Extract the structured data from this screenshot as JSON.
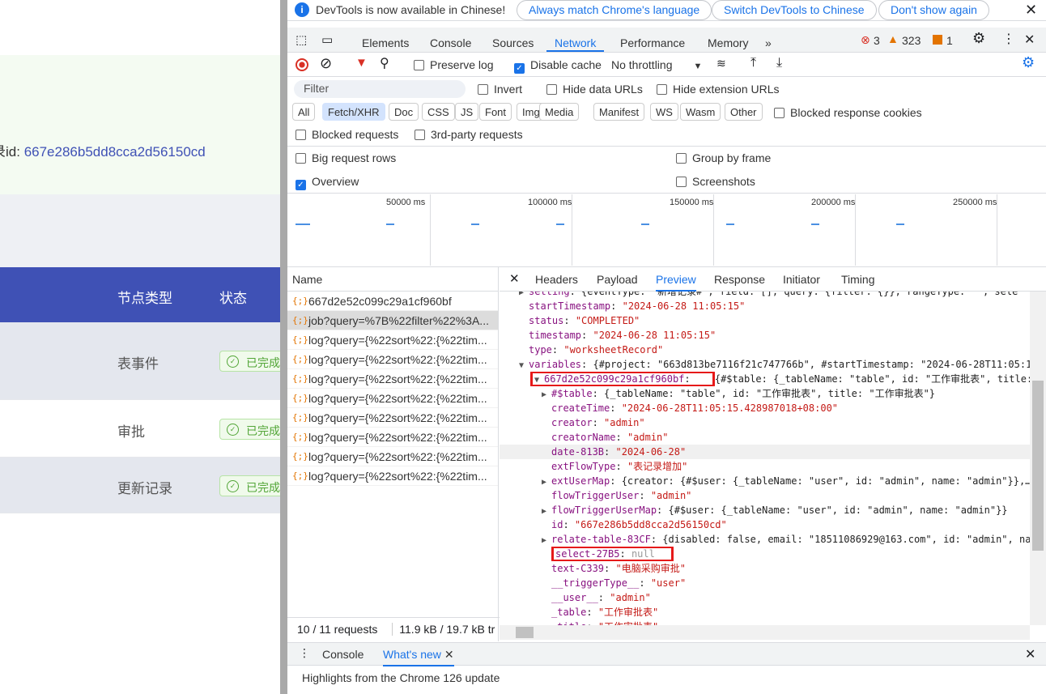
{
  "page": {
    "record_label": "录id: ",
    "record_id": "667e286b5dd8cca2d56150cd",
    "table_headers": [
      "节点类型",
      "状态"
    ],
    "rows": [
      {
        "type": "表事件",
        "status": "已完成"
      },
      {
        "type": "审批",
        "status": "已完成"
      },
      {
        "type": "更新记录",
        "status": "已完成"
      }
    ]
  },
  "devtools": {
    "infobar": {
      "message": "DevTools is now available in Chinese!",
      "buttons": [
        "Always match Chrome's language",
        "Switch DevTools to Chinese",
        "Don't show again"
      ]
    },
    "tabs": [
      "Elements",
      "Console",
      "Sources",
      "Network",
      "Performance",
      "Memory"
    ],
    "active_tab": "Network",
    "counts": {
      "errors": "3",
      "warnings": "323",
      "issues": "1"
    },
    "toolbar": {
      "preserve_log": "Preserve log",
      "disable_cache": "Disable cache",
      "throttling": "No throttling"
    },
    "filter": {
      "placeholder": "Filter",
      "invert": "Invert",
      "hide_data": "Hide data URLs",
      "hide_ext": "Hide extension URLs"
    },
    "types": [
      "All",
      "Fetch/XHR",
      "Doc",
      "CSS",
      "JS",
      "Font",
      "Img",
      "Media",
      "Manifest",
      "WS",
      "Wasm",
      "Other"
    ],
    "active_type": "Fetch/XHR",
    "blocked_cookies": "Blocked response cookies",
    "blocked_requests": "Blocked requests",
    "third_party": "3rd-party requests",
    "big_rows": "Big request rows",
    "group_frame": "Group by frame",
    "overview": "Overview",
    "screenshots": "Screenshots",
    "timeline_ticks": [
      "50000 ms",
      "100000 ms",
      "150000 ms",
      "200000 ms",
      "250000 ms"
    ],
    "name_header": "Name",
    "requests": [
      "667d2e52c099c29a1cf960bf",
      "job?query=%7B%22filter%22%3A...",
      "log?query={%22sort%22:{%22tim...",
      "log?query={%22sort%22:{%22tim...",
      "log?query={%22sort%22:{%22tim...",
      "log?query={%22sort%22:{%22tim...",
      "log?query={%22sort%22:{%22tim...",
      "log?query={%22sort%22:{%22tim...",
      "log?query={%22sort%22:{%22tim...",
      "log?query={%22sort%22:{%22tim..."
    ],
    "detail_tabs": [
      "Headers",
      "Payload",
      "Preview",
      "Response",
      "Initiator",
      "Timing"
    ],
    "active_detail": "Preview",
    "status_bar": {
      "requests": "10 / 11 requests",
      "size": "11.9 kB / 19.7 kB tr"
    },
    "drawer": {
      "tabs": [
        "Console",
        "What's new"
      ],
      "text": "Highlights from the Chrome 126 update"
    },
    "preview": [
      {
        "i": 0,
        "t": "c",
        "k": "setting",
        "v": "{eventType: \"新增记录#\", field: [], query: {filter: {}}, rangeType: \"\", sele"
      },
      {
        "i": 0,
        "k": "startTimestamp",
        "v": "\"2024-06-28 11:05:15\"",
        "s": 1
      },
      {
        "i": 0,
        "k": "status",
        "v": "\"COMPLETED\"",
        "s": 1
      },
      {
        "i": 0,
        "k": "timestamp",
        "v": "\"2024-06-28 11:05:15\"",
        "s": 1
      },
      {
        "i": 0,
        "k": "type",
        "v": "\"worksheetRecord\"",
        "s": 1
      },
      {
        "i": 0,
        "t": "o",
        "k": "variables",
        "v": "{#project: \"663d813be7116f21c747766b\", #startTimestamp: \"2024-06-28T11:05:1"
      },
      {
        "i": 1,
        "t": "o",
        "k": "667d2e52c099c29a1cf960bf",
        "v": "{#$table: {_tableName: \"table\", id: \"工作审批表\", title: \"工",
        "box": 1
      },
      {
        "i": 2,
        "t": "c",
        "k": "#$table",
        "v": "{_tableName: \"table\", id: \"工作审批表\", title: \"工作审批表\"}"
      },
      {
        "i": 2,
        "k": "createTime",
        "v": "\"2024-06-28T11:05:15.428987018+08:00\"",
        "s": 1
      },
      {
        "i": 2,
        "k": "creator",
        "v": "\"admin\"",
        "s": 1
      },
      {
        "i": 2,
        "k": "creatorName",
        "v": "\"admin\"",
        "s": 1
      },
      {
        "i": 2,
        "k": "date-813B",
        "v": "\"2024-06-28\"",
        "s": 1,
        "hl": 1
      },
      {
        "i": 2,
        "k": "extFlowType",
        "v": "\"表记录增加\"",
        "s": 1
      },
      {
        "i": 2,
        "t": "c",
        "k": "extUserMap",
        "v": "{creator: {#$user: {_tableName: \"user\", id: \"admin\", name: \"admin\"}},…"
      },
      {
        "i": 2,
        "k": "flowTriggerUser",
        "v": "\"admin\"",
        "s": 1
      },
      {
        "i": 2,
        "t": "c",
        "k": "flowTriggerUserMap",
        "v": "{#$user: {_tableName: \"user\", id: \"admin\", name: \"admin\"}}"
      },
      {
        "i": 2,
        "k": "id",
        "v": "\"667e286b5dd8cca2d56150cd\"",
        "s": 1
      },
      {
        "i": 2,
        "t": "c",
        "k": "relate-table-83CF",
        "v": "{disabled: false, email: \"18511086929@163.com\", id: \"admin\", na"
      },
      {
        "i": 2,
        "k": "select-27B5",
        "v": "null",
        "nul": 1,
        "box": 1
      },
      {
        "i": 2,
        "k": "text-C339",
        "v": "\"电脑采购审批\"",
        "s": 1
      },
      {
        "i": 2,
        "k": "__triggerType__",
        "v": "\"user\"",
        "s": 1
      },
      {
        "i": 2,
        "k": "__user__",
        "v": "\"admin\"",
        "s": 1
      },
      {
        "i": 2,
        "k": "_table",
        "v": "\"工作审批表\"",
        "s": 1
      },
      {
        "i": 2,
        "k": "_title",
        "v": "\"工作审批表\"",
        "s": 1
      }
    ]
  },
  "colors": {
    "accent": "#1a73e8",
    "table_header": "#3f51b5",
    "success": "#52a537",
    "highlight_box": "#e61919"
  }
}
